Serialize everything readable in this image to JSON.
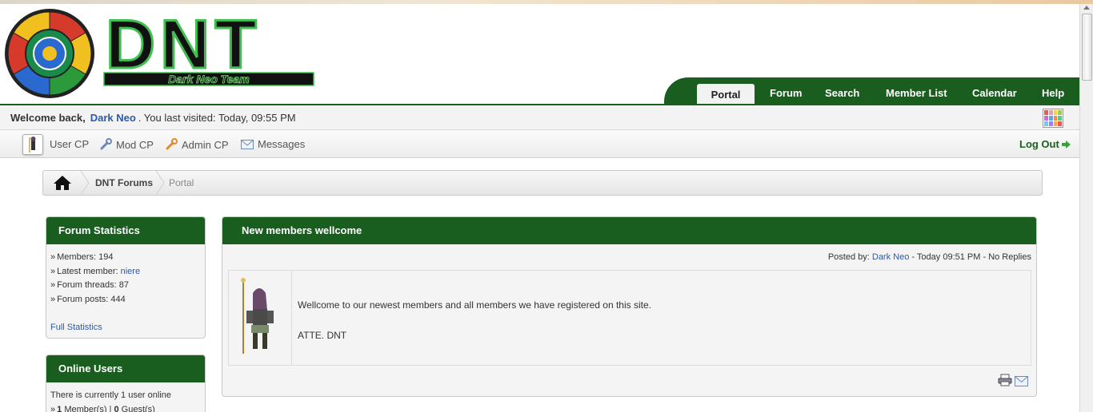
{
  "header": {
    "logo_text": "DNT",
    "logo_subtitle": "Dark Neo Team"
  },
  "nav": {
    "items": [
      "Portal",
      "Forum",
      "Search",
      "Member List",
      "Calendar",
      "Help"
    ],
    "active": "Portal"
  },
  "welcome": {
    "prefix": "Welcome back,",
    "username": "Dark Neo",
    "suffix": ". You last visited: Today, 09:55 PM"
  },
  "toolbar": {
    "user_cp": "User CP",
    "mod_cp": "Mod CP",
    "admin_cp": "Admin CP",
    "messages": "Messages",
    "logout": "Log Out"
  },
  "breadcrumb": {
    "items": [
      "DNT Forums",
      "Portal"
    ]
  },
  "stats": {
    "title": "Forum Statistics",
    "members_label": "Members:",
    "members_value": "194",
    "latest_label": "Latest member:",
    "latest_value": "niere",
    "threads_label": "Forum threads:",
    "threads_value": "87",
    "posts_label": "Forum posts:",
    "posts_value": "444",
    "full_link": "Full Statistics"
  },
  "online": {
    "title": "Online Users",
    "line1": "There is currently 1 user online",
    "members_count": "1",
    "members_label": "Member(s)",
    "guests_count": "0",
    "guests_label": "Guest(s)"
  },
  "post": {
    "title": "New members wellcome",
    "posted_by_label": "Posted by:",
    "author": "Dark Neo",
    "meta": "- Today 09:51 PM - No Replies",
    "body_line1": "Wellcome to our newest members and all members we have registered on this site.",
    "body_line2": "ATTE. DNT"
  },
  "colors": {
    "brand_green": "#1a5e1f",
    "link_blue": "#2a5aa8"
  }
}
